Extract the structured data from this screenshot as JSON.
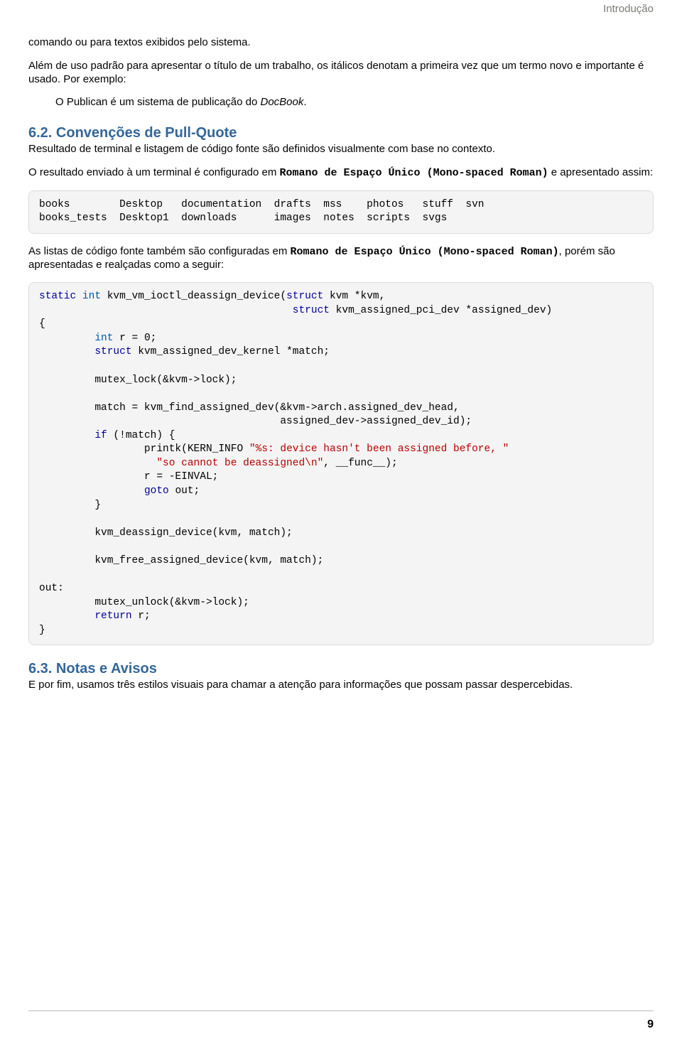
{
  "header": {
    "label": "Introdução"
  },
  "para1": "comando ou para textos exibidos pelo sistema.",
  "para2": "Além de uso padrão para apresentar o título de um trabalho, os itálicos denotam a primeira vez que um termo novo e importante é usado. Por exemplo:",
  "example1_pre": "O Publican é um sistema de publicação do ",
  "example1_it": "DocBook",
  "example1_post": ".",
  "h62": "6.2. Convenções de Pull-Quote",
  "para3": "Resultado de terminal e listagem de código fonte são definidos visualmente com base no contexto.",
  "para4_pre": "O resultado enviado à um terminal é configurado em ",
  "para4_mono": "Romano de Espaço Único (Mono-spaced Roman)",
  "para4_post": " e apresentado assim:",
  "terminal": "books        Desktop   documentation  drafts  mss    photos   stuff  svn\nbooks_tests  Desktop1  downloads      images  notes  scripts  svgs",
  "para5_pre": "As listas de código fonte também são configuradas em ",
  "para5_mono": "Romano de Espaço Único (Mono-spaced Roman)",
  "para5_post": ", porém são apresentadas e realçadas como a seguir:",
  "code": {
    "l01a": "static",
    "l01b": " int",
    "l01c": " kvm_vm_ioctl_deassign_device(",
    "l01d": "struct",
    "l01e": " kvm *kvm,",
    "l02a": "                                         ",
    "l02b": "struct",
    "l02c": " kvm_assigned_pci_dev *assigned_dev)",
    "l03": "{",
    "l04a": "         ",
    "l04b": "int",
    "l04c": " r = 0;",
    "l05a": "         ",
    "l05b": "struct",
    "l05c": " kvm_assigned_dev_kernel *match;",
    "l06": "",
    "l07": "         mutex_lock(&kvm->lock);",
    "l08": "",
    "l09": "         match = kvm_find_assigned_dev(&kvm->arch.assigned_dev_head,",
    "l10": "                                       assigned_dev->assigned_dev_id);",
    "l11a": "         ",
    "l11b": "if",
    "l11c": " (!match) {",
    "l12a": "                 printk(KERN_INFO ",
    "l12b": "\"%s: device hasn't been assigned before, \"",
    "l13a": "                   ",
    "l13b": "\"so cannot be deassigned\\n\"",
    "l13c": ", __func__);",
    "l14": "                 r = -EINVAL;",
    "l15a": "                 ",
    "l15b": "goto",
    "l15c": " out;",
    "l16": "         }",
    "l17": "",
    "l18": "         kvm_deassign_device(kvm, match);",
    "l19": "",
    "l20": "         kvm_free_assigned_device(kvm, match);",
    "l21": "",
    "l22": "out:",
    "l23": "         mutex_unlock(&kvm->lock);",
    "l24a": "         ",
    "l24b": "return",
    "l24c": " r;",
    "l25": "}"
  },
  "h63": "6.3. Notas e Avisos",
  "para6": "E por fim, usamos três estilos visuais para chamar a atenção para informações que possam passar despercebidas.",
  "pagenum": "9"
}
